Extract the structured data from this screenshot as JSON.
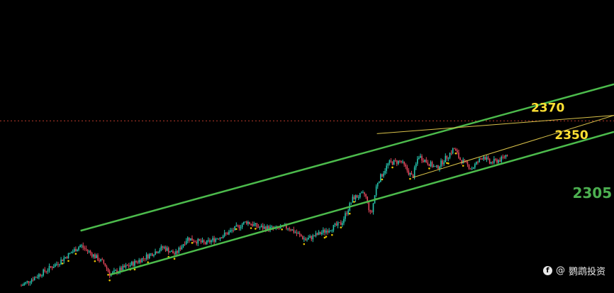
{
  "chart_data": {
    "type": "candlestick",
    "ylim": [
      2220,
      2380
    ],
    "grid": false,
    "colors": {
      "background": "#000000",
      "up_candle": "#26c6b0",
      "down_candle": "#e0455a",
      "channel_line": "#4cbb4c",
      "wedge_line": "#d9c24a",
      "level_yellow": "#ffe033",
      "level_green": "#4caf50",
      "reference_line": "#b83a2a",
      "marker_dot": "#e8c400"
    },
    "price_points": [
      [
        0,
        2224
      ],
      [
        0.06,
        2236
      ],
      [
        0.1,
        2246
      ],
      [
        0.14,
        2236
      ],
      [
        0.15,
        2230
      ],
      [
        0.2,
        2238
      ],
      [
        0.24,
        2245
      ],
      [
        0.26,
        2241
      ],
      [
        0.28,
        2250
      ],
      [
        0.31,
        2247
      ],
      [
        0.35,
        2253
      ],
      [
        0.38,
        2259
      ],
      [
        0.4,
        2256
      ],
      [
        0.43,
        2255
      ],
      [
        0.45,
        2256
      ],
      [
        0.48,
        2249
      ],
      [
        0.5,
        2252
      ],
      [
        0.54,
        2258
      ],
      [
        0.56,
        2272
      ],
      [
        0.58,
        2274
      ],
      [
        0.59,
        2262
      ],
      [
        0.6,
        2280
      ],
      [
        0.62,
        2291
      ],
      [
        0.64,
        2292
      ],
      [
        0.66,
        2283
      ],
      [
        0.67,
        2295
      ],
      [
        0.7,
        2288
      ],
      [
        0.72,
        2295
      ],
      [
        0.73,
        2299
      ],
      [
        0.74,
        2293
      ],
      [
        0.76,
        2288
      ],
      [
        0.78,
        2295
      ],
      [
        0.79,
        2291
      ],
      [
        0.81,
        2293
      ],
      [
        0.82,
        2296
      ]
    ],
    "lines": [
      {
        "name": "channel-upper",
        "style": "channel",
        "points": [
          [
            0.1,
            2254
          ],
          [
            1.0,
            2334
          ]
        ]
      },
      {
        "name": "channel-lower",
        "style": "channel",
        "points": [
          [
            0.15,
            2230
          ],
          [
            1.0,
            2308
          ]
        ]
      },
      {
        "name": "wedge-upper",
        "style": "wedge",
        "points": [
          [
            0.6,
            2307
          ],
          [
            1.0,
            2317
          ]
        ]
      },
      {
        "name": "wedge-lower",
        "style": "wedge",
        "points": [
          [
            0.66,
            2283
          ],
          [
            1.0,
            2317
          ]
        ]
      }
    ],
    "reference_line": {
      "y": 2314
    },
    "annotations": [
      {
        "label": "2370",
        "color": "yellow",
        "x": 0.86,
        "y": 2319
      },
      {
        "label": "2350",
        "color": "yellow",
        "x": 0.9,
        "y": 2304
      },
      {
        "label": "2305",
        "color": "green",
        "x": 0.93,
        "y": 2272
      }
    ]
  },
  "watermark": {
    "icon": "facebook-icon",
    "icon_glyph": "f",
    "symbol": "@",
    "text": "鹦鹉投资"
  }
}
